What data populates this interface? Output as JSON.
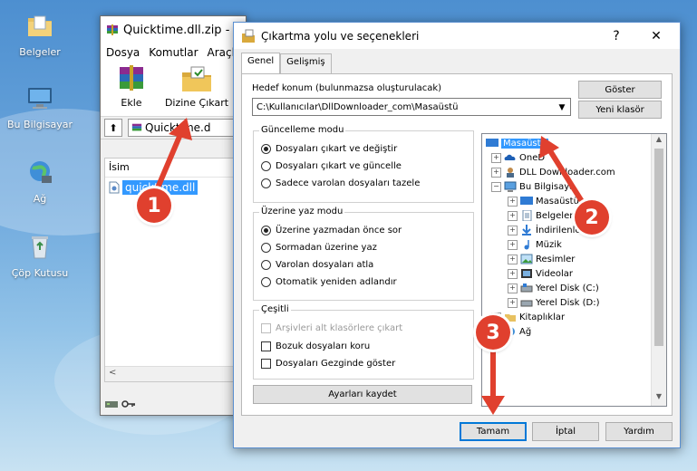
{
  "desktop": {
    "icons": [
      {
        "label": "Belgeler",
        "icon": "documents-folder-icon"
      },
      {
        "label": "Bu Bilgisayar",
        "icon": "computer-icon"
      },
      {
        "label": "Ağ",
        "icon": "network-icon"
      },
      {
        "label": "Çöp Kutusu",
        "icon": "recycle-bin-icon"
      }
    ]
  },
  "winrar": {
    "title": "Quicktime.dll.zip - W",
    "menu": [
      "Dosya",
      "Komutlar",
      "Araçla"
    ],
    "toolbar": {
      "add_label": "Ekle",
      "extract_label": "Dizine Çıkart"
    },
    "address": "Quicktime.d",
    "column_name": "İsim",
    "file": "quicktime.dll",
    "scroll_left": "<"
  },
  "dialog": {
    "title": "Çıkartma yolu ve seçenekleri",
    "help_btn": "?",
    "close_btn": "✕",
    "tabs": [
      "Genel",
      "Gelişmiş"
    ],
    "dest_label": "Hedef konum (bulunmazsa oluşturulacak)",
    "dest_value": "C:\\Kullanıcılar\\DllDownloader_com\\Masaüstü",
    "show_btn": "Göster",
    "new_folder_btn": "Yeni klasör",
    "update_group": {
      "title": "Güncelleme modu",
      "options": [
        "Dosyaları çıkart ve değiştir",
        "Dosyaları çıkart ve güncelle",
        "Sadece varolan dosyaları tazele"
      ],
      "selected": 0
    },
    "overwrite_group": {
      "title": "Üzerine yaz modu",
      "options": [
        "Üzerine yazmadan önce sor",
        "Sormadan üzerine yaz",
        "Varolan dosyaları atla",
        "Otomatik yeniden adlandır"
      ],
      "selected": 0
    },
    "misc_group": {
      "title": "Çeşitli",
      "options": [
        "Arşivleri alt klasörlere çıkart",
        "Bozuk dosyaları koru",
        "Dosyaları Gezginde göster"
      ]
    },
    "save_settings_btn": "Ayarları kaydet",
    "tree": [
      {
        "label": "Masaüstü",
        "icon": "desktop-icon",
        "selected": true
      },
      {
        "label": "OneD",
        "icon": "onedrive-icon"
      },
      {
        "label": "DLL Downloader.com",
        "icon": "user-icon"
      },
      {
        "label": "Bu Bilgisaya",
        "icon": "computer-icon"
      },
      {
        "label": "Masaüstü",
        "icon": "desktop-icon"
      },
      {
        "label": "Belgeler",
        "icon": "documents-icon"
      },
      {
        "label": "İndirilenler",
        "icon": "downloads-icon"
      },
      {
        "label": "Müzik",
        "icon": "music-icon"
      },
      {
        "label": "Resimler",
        "icon": "pictures-icon"
      },
      {
        "label": "Videolar",
        "icon": "videos-icon"
      },
      {
        "label": "Yerel Disk (C:)",
        "icon": "drive-icon"
      },
      {
        "label": "Yerel Disk (D:)",
        "icon": "drive-icon"
      },
      {
        "label": "Kitaplıklar",
        "icon": "libraries-icon"
      },
      {
        "label": "Ağ",
        "icon": "network-icon"
      }
    ],
    "ok_btn": "Tamam",
    "cancel_btn": "İptal",
    "help_button": "Yardım"
  },
  "annotations": {
    "step1": "1",
    "step2": "2",
    "step3": "3",
    "color": "#e0402e"
  }
}
